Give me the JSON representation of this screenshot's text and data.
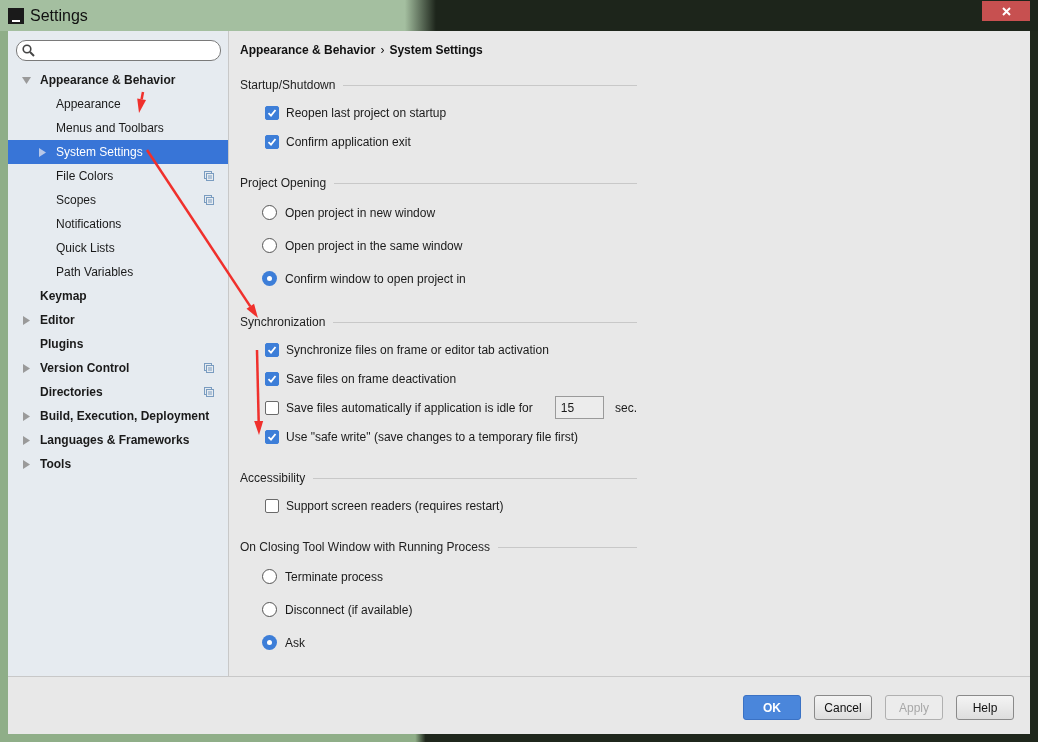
{
  "window": {
    "title": "Settings"
  },
  "sidebar": {
    "items": [
      {
        "label": "Appearance & Behavior",
        "expanded": true,
        "selected": false,
        "project_icon": false,
        "children": [
          {
            "label": "Appearance",
            "selected": false,
            "project_icon": false
          },
          {
            "label": "Menus and Toolbars",
            "selected": false,
            "project_icon": false
          },
          {
            "label": "System Settings",
            "expanded": false,
            "selected": true,
            "project_icon": false
          },
          {
            "label": "File Colors",
            "selected": false,
            "project_icon": true
          },
          {
            "label": "Scopes",
            "selected": false,
            "project_icon": true
          },
          {
            "label": "Notifications",
            "selected": false,
            "project_icon": false
          },
          {
            "label": "Quick Lists",
            "selected": false,
            "project_icon": false
          },
          {
            "label": "Path Variables",
            "selected": false,
            "project_icon": false
          }
        ]
      },
      {
        "label": "Keymap",
        "selected": false,
        "project_icon": false
      },
      {
        "label": "Editor",
        "expanded": false,
        "selected": false,
        "project_icon": false
      },
      {
        "label": "Plugins",
        "selected": false,
        "project_icon": false
      },
      {
        "label": "Version Control",
        "expanded": false,
        "selected": false,
        "project_icon": true
      },
      {
        "label": "Directories",
        "selected": false,
        "project_icon": true
      },
      {
        "label": "Build, Execution, Deployment",
        "expanded": false,
        "selected": false,
        "project_icon": false
      },
      {
        "label": "Languages & Frameworks",
        "expanded": false,
        "selected": false,
        "project_icon": false
      },
      {
        "label": "Tools",
        "expanded": false,
        "selected": false,
        "project_icon": false
      }
    ]
  },
  "breadcrumb": {
    "items": [
      "Appearance & Behavior",
      "System Settings"
    ],
    "separator": "›"
  },
  "sections": [
    {
      "title": "Startup/Shutdown",
      "options": [
        {
          "kind": "checkbox",
          "label": "Reopen last project on startup",
          "checked": true
        },
        {
          "kind": "checkbox",
          "label": "Confirm application exit",
          "checked": true
        }
      ]
    },
    {
      "title": "Project Opening",
      "options": [
        {
          "kind": "radio",
          "label": "Open project in new window",
          "selected": false
        },
        {
          "kind": "radio",
          "label": "Open project in the same window",
          "selected": false
        },
        {
          "kind": "radio",
          "label": "Confirm window to open project in",
          "selected": true
        }
      ]
    },
    {
      "title": "Synchronization",
      "options": [
        {
          "kind": "checkbox",
          "label": "Synchronize files on frame or editor tab activation",
          "checked": true
        },
        {
          "kind": "checkbox",
          "label": "Save files on frame deactivation",
          "checked": true
        },
        {
          "kind": "checkbox_field",
          "label": "Save files automatically if application is idle for",
          "checked": false,
          "value": "15",
          "suffix": "sec."
        },
        {
          "kind": "checkbox",
          "label": "Use \"safe write\" (save changes to a temporary file first)",
          "checked": true
        }
      ]
    },
    {
      "title": "Accessibility",
      "options": [
        {
          "kind": "checkbox",
          "label": "Support screen readers (requires restart)",
          "checked": false
        }
      ]
    },
    {
      "title": "On Closing Tool Window with Running Process",
      "options": [
        {
          "kind": "radio",
          "label": "Terminate process",
          "selected": false
        },
        {
          "kind": "radio",
          "label": "Disconnect (if available)",
          "selected": false
        },
        {
          "kind": "radio",
          "label": "Ask",
          "selected": true
        }
      ]
    }
  ],
  "buttons": [
    {
      "label": "OK",
      "kind": "primary",
      "disabled": false
    },
    {
      "label": "Cancel",
      "kind": "default",
      "disabled": false
    },
    {
      "label": "Apply",
      "kind": "default",
      "disabled": true
    },
    {
      "label": "Help",
      "kind": "default",
      "disabled": false
    }
  ]
}
